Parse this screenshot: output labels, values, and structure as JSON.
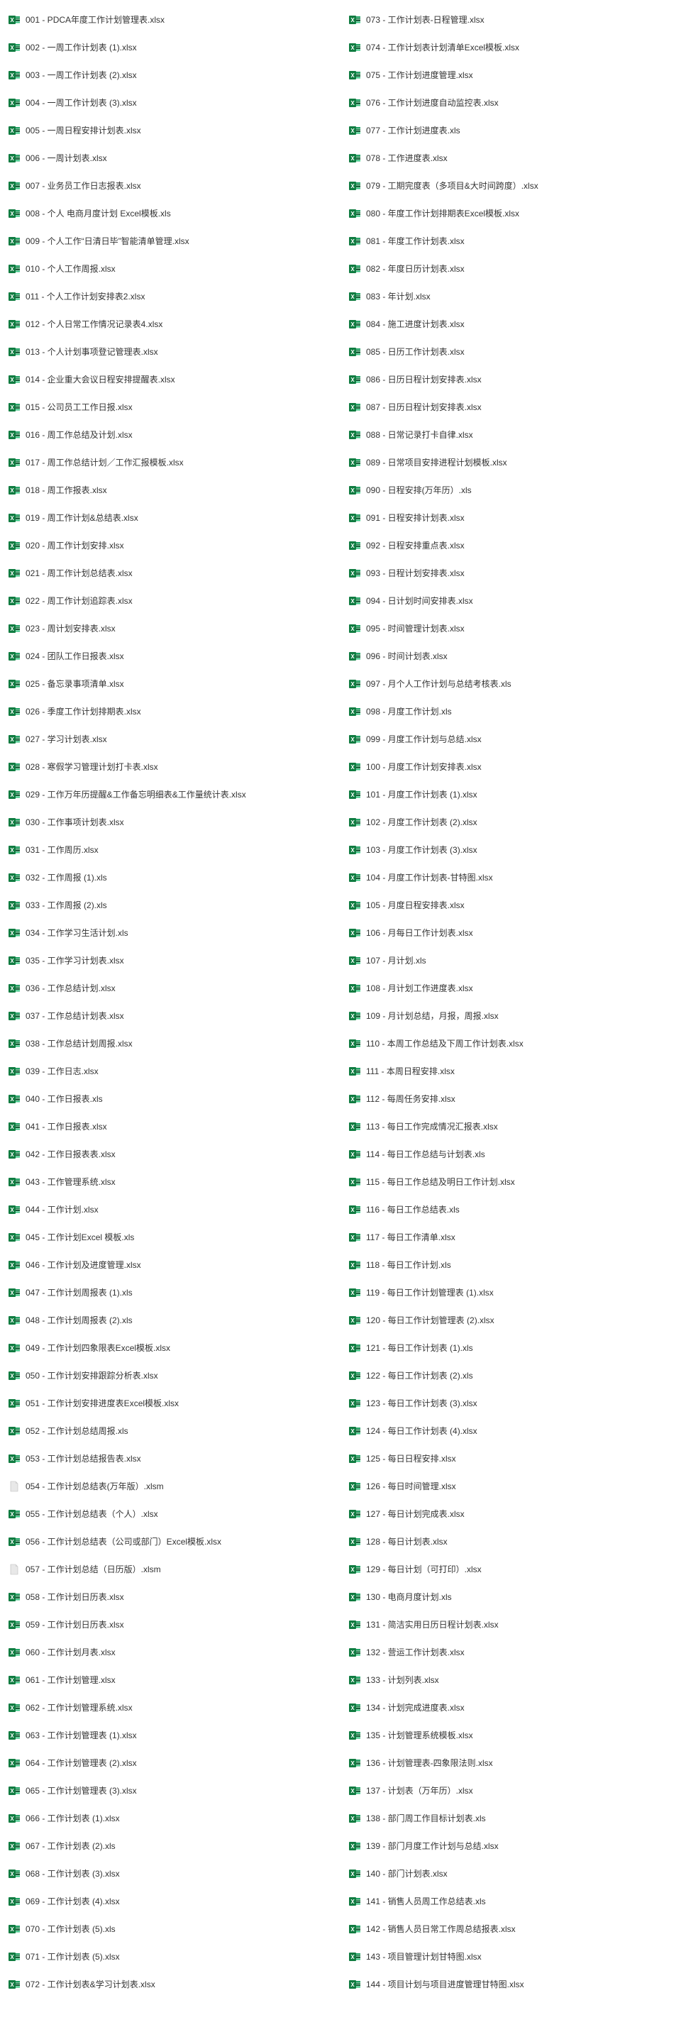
{
  "column1": [
    {
      "num": "001",
      "name": "PDCA年度工作计划管理表.xlsx",
      "type": "xlsx"
    },
    {
      "num": "002",
      "name": "一周工作计划表 (1).xlsx",
      "type": "xlsx"
    },
    {
      "num": "003",
      "name": "一周工作计划表 (2).xlsx",
      "type": "xlsx"
    },
    {
      "num": "004",
      "name": "一周工作计划表 (3).xlsx",
      "type": "xlsx"
    },
    {
      "num": "005",
      "name": "一周日程安排计划表.xlsx",
      "type": "xlsx"
    },
    {
      "num": "006",
      "name": "一周计划表.xlsx",
      "type": "xlsx"
    },
    {
      "num": "007",
      "name": "业务员工作日志报表.xlsx",
      "type": "xlsx"
    },
    {
      "num": "008",
      "name": "个人 电商月度计划 Excel模板.xls",
      "type": "xls"
    },
    {
      "num": "009",
      "name": "个人工作“日清日毕”智能清单管理.xlsx",
      "type": "xlsx"
    },
    {
      "num": "010",
      "name": "个人工作周报.xlsx",
      "type": "xlsx"
    },
    {
      "num": "011",
      "name": "个人工作计划安排表2.xlsx",
      "type": "xlsx"
    },
    {
      "num": "012",
      "name": "个人日常工作情况记录表4.xlsx",
      "type": "xlsx"
    },
    {
      "num": "013",
      "name": "个人计划事项登记管理表.xlsx",
      "type": "xlsx"
    },
    {
      "num": "014",
      "name": "企业重大会议日程安排提醒表.xlsx",
      "type": "xlsx"
    },
    {
      "num": "015",
      "name": "公司员工工作日报.xlsx",
      "type": "xlsx"
    },
    {
      "num": "016",
      "name": "周工作总结及计划.xlsx",
      "type": "xlsx"
    },
    {
      "num": "017",
      "name": "周工作总结计划／工作汇报模板.xlsx",
      "type": "xlsx"
    },
    {
      "num": "018",
      "name": "周工作报表.xlsx",
      "type": "xlsx"
    },
    {
      "num": "019",
      "name": "周工作计划&总结表.xlsx",
      "type": "xlsx"
    },
    {
      "num": "020",
      "name": "周工作计划安排.xlsx",
      "type": "xlsx"
    },
    {
      "num": "021",
      "name": "周工作计划总结表.xlsx",
      "type": "xlsx"
    },
    {
      "num": "022",
      "name": "周工作计划追踪表.xlsx",
      "type": "xlsx"
    },
    {
      "num": "023",
      "name": "周计划安排表.xlsx",
      "type": "xlsx"
    },
    {
      "num": "024",
      "name": "团队工作日报表.xlsx",
      "type": "xlsx"
    },
    {
      "num": "025",
      "name": "备忘录事项清单.xlsx",
      "type": "xlsx"
    },
    {
      "num": "026",
      "name": "季度工作计划排期表.xlsx",
      "type": "xlsx"
    },
    {
      "num": "027",
      "name": "学习计划表.xlsx",
      "type": "xlsx"
    },
    {
      "num": "028",
      "name": "寒假学习管理计划打卡表.xlsx",
      "type": "xlsx"
    },
    {
      "num": "029",
      "name": "工作万年历提醒&工作备忘明细表&工作量统计表.xlsx",
      "type": "xlsx"
    },
    {
      "num": "030",
      "name": "工作事项计划表.xlsx",
      "type": "xlsx"
    },
    {
      "num": "031",
      "name": "工作周历.xlsx",
      "type": "xlsx"
    },
    {
      "num": "032",
      "name": "工作周报 (1).xls",
      "type": "xls"
    },
    {
      "num": "033",
      "name": "工作周报 (2).xls",
      "type": "xls"
    },
    {
      "num": "034",
      "name": "工作学习生活计划.xls",
      "type": "xls"
    },
    {
      "num": "035",
      "name": "工作学习计划表.xlsx",
      "type": "xlsx"
    },
    {
      "num": "036",
      "name": "工作总结计划.xlsx",
      "type": "xlsx"
    },
    {
      "num": "037",
      "name": "工作总结计划表.xlsx",
      "type": "xlsx"
    },
    {
      "num": "038",
      "name": "工作总结计划周报.xlsx",
      "type": "xlsx"
    },
    {
      "num": "039",
      "name": "工作日志.xlsx",
      "type": "xlsx"
    },
    {
      "num": "040",
      "name": "工作日报表.xls",
      "type": "xls"
    },
    {
      "num": "041",
      "name": "工作日报表.xlsx",
      "type": "xlsx"
    },
    {
      "num": "042",
      "name": "工作日报表表.xlsx",
      "type": "xlsx"
    },
    {
      "num": "043",
      "name": "工作管理系统.xlsx",
      "type": "xlsx"
    },
    {
      "num": "044",
      "name": "工作计划.xlsx",
      "type": "xlsx"
    },
    {
      "num": "045",
      "name": "工作计划Excel 模板.xls",
      "type": "xls"
    },
    {
      "num": "046",
      "name": "工作计划及进度管理.xlsx",
      "type": "xlsx"
    },
    {
      "num": "047",
      "name": "工作计划周报表 (1).xls",
      "type": "xls"
    },
    {
      "num": "048",
      "name": "工作计划周报表 (2).xls",
      "type": "xls"
    },
    {
      "num": "049",
      "name": "工作计划四象限表Excel模板.xlsx",
      "type": "xlsx"
    },
    {
      "num": "050",
      "name": "工作计划安排跟踪分析表.xlsx",
      "type": "xlsx"
    },
    {
      "num": "051",
      "name": "工作计划安排进度表Excel模板.xlsx",
      "type": "xlsx"
    },
    {
      "num": "052",
      "name": "工作计划总结周报.xls",
      "type": "xls"
    },
    {
      "num": "053",
      "name": "工作计划总结报告表.xlsx",
      "type": "xlsx"
    },
    {
      "num": "054",
      "name": "工作计划总结表(万年版）.xlsm",
      "type": "xlsm"
    },
    {
      "num": "055",
      "name": "工作计划总结表（个人）.xlsx",
      "type": "xlsx"
    },
    {
      "num": "056",
      "name": "工作计划总结表（公司或部门）Excel模板.xlsx",
      "type": "xlsx"
    },
    {
      "num": "057",
      "name": "工作计划总结（日历版）.xlsm",
      "type": "xlsm"
    },
    {
      "num": "058",
      "name": "工作计划日历表.xlsx",
      "type": "xlsx"
    },
    {
      "num": "059",
      "name": "工作计划日历表.xlsx",
      "type": "xlsx"
    },
    {
      "num": "060",
      "name": "工作计划月表.xlsx",
      "type": "xlsx"
    },
    {
      "num": "061",
      "name": "工作计划管理.xlsx",
      "type": "xlsx"
    },
    {
      "num": "062",
      "name": "工作计划管理系统.xlsx",
      "type": "xlsx"
    },
    {
      "num": "063",
      "name": "工作计划管理表 (1).xlsx",
      "type": "xlsx"
    },
    {
      "num": "064",
      "name": "工作计划管理表 (2).xlsx",
      "type": "xlsx"
    },
    {
      "num": "065",
      "name": "工作计划管理表 (3).xlsx",
      "type": "xlsx"
    },
    {
      "num": "066",
      "name": "工作计划表 (1).xlsx",
      "type": "xlsx"
    },
    {
      "num": "067",
      "name": "工作计划表 (2).xls",
      "type": "xls"
    },
    {
      "num": "068",
      "name": "工作计划表 (3).xlsx",
      "type": "xlsx"
    },
    {
      "num": "069",
      "name": "工作计划表 (4).xlsx",
      "type": "xlsx"
    },
    {
      "num": "070",
      "name": "工作计划表 (5).xls",
      "type": "xls"
    },
    {
      "num": "071",
      "name": "工作计划表 (5).xlsx",
      "type": "xlsx"
    },
    {
      "num": "072",
      "name": "工作计划表&学习计划表.xlsx",
      "type": "xlsx"
    }
  ],
  "column2": [
    {
      "num": "073",
      "name": "工作计划表-日程管理.xlsx",
      "type": "xlsx"
    },
    {
      "num": "074",
      "name": "工作计划表计划清单Excel模板.xlsx",
      "type": "xlsx"
    },
    {
      "num": "075",
      "name": "工作计划进度管理.xlsx",
      "type": "xlsx"
    },
    {
      "num": "076",
      "name": "工作计划进度自动监控表.xlsx",
      "type": "xlsx"
    },
    {
      "num": "077",
      "name": "工作计划进度表.xls",
      "type": "xls"
    },
    {
      "num": "078",
      "name": "工作进度表.xlsx",
      "type": "xlsx"
    },
    {
      "num": "079",
      "name": "工期完度表（多项目&大时间跨度）.xlsx",
      "type": "xlsx"
    },
    {
      "num": "080",
      "name": "年度工作计划排期表Excel模板.xlsx",
      "type": "xlsx"
    },
    {
      "num": "081",
      "name": "年度工作计划表.xlsx",
      "type": "xlsx"
    },
    {
      "num": "082",
      "name": "年度日历计划表.xlsx",
      "type": "xlsx"
    },
    {
      "num": "083",
      "name": "年计划.xlsx",
      "type": "xlsx"
    },
    {
      "num": "084",
      "name": "施工进度计划表.xlsx",
      "type": "xlsx"
    },
    {
      "num": "085",
      "name": "日历工作计划表.xlsx",
      "type": "xlsx"
    },
    {
      "num": "086",
      "name": "日历日程计划安排表.xlsx",
      "type": "xlsx"
    },
    {
      "num": "087",
      "name": "日历日程计划安排表.xlsx",
      "type": "xlsx"
    },
    {
      "num": "088",
      "name": "日常记录打卡自律.xlsx",
      "type": "xlsx"
    },
    {
      "num": "089",
      "name": "日常项目安排进程计划模板.xlsx",
      "type": "xlsx"
    },
    {
      "num": "090",
      "name": "日程安排(万年历）.xls",
      "type": "xls"
    },
    {
      "num": "091",
      "name": "日程安排计划表.xlsx",
      "type": "xlsx"
    },
    {
      "num": "092",
      "name": "日程安排重点表.xlsx",
      "type": "xlsx"
    },
    {
      "num": "093",
      "name": "日程计划安排表.xlsx",
      "type": "xlsx"
    },
    {
      "num": "094",
      "name": "日计划时间安排表.xlsx",
      "type": "xlsx"
    },
    {
      "num": "095",
      "name": "时间管理计划表.xlsx",
      "type": "xlsx"
    },
    {
      "num": "096",
      "name": "时间计划表.xlsx",
      "type": "xlsx"
    },
    {
      "num": "097",
      "name": "月个人工作计划与总结考核表.xls",
      "type": "xls"
    },
    {
      "num": "098",
      "name": "月度工作计划.xls",
      "type": "xls"
    },
    {
      "num": "099",
      "name": "月度工作计划与总结.xlsx",
      "type": "xlsx"
    },
    {
      "num": "100",
      "name": "月度工作计划安排表.xlsx",
      "type": "xlsx"
    },
    {
      "num": "101",
      "name": "月度工作计划表 (1).xlsx",
      "type": "xlsx"
    },
    {
      "num": "102",
      "name": "月度工作计划表 (2).xlsx",
      "type": "xlsx"
    },
    {
      "num": "103",
      "name": "月度工作计划表 (3).xlsx",
      "type": "xlsx"
    },
    {
      "num": "104",
      "name": "月度工作计划表-甘特图.xlsx",
      "type": "xlsx"
    },
    {
      "num": "105",
      "name": "月度日程安排表.xlsx",
      "type": "xlsx"
    },
    {
      "num": "106",
      "name": "月每日工作计划表.xlsx",
      "type": "xlsx"
    },
    {
      "num": "107",
      "name": "月计划.xls",
      "type": "xls"
    },
    {
      "num": "108",
      "name": "月计划工作进度表.xlsx",
      "type": "xlsx"
    },
    {
      "num": "109",
      "name": "月计划总结，月报，周报.xlsx",
      "type": "xlsx"
    },
    {
      "num": "110",
      "name": "本周工作总结及下周工作计划表.xlsx",
      "type": "xlsx"
    },
    {
      "num": "111",
      "name": "本周日程安排.xlsx",
      "type": "xlsx"
    },
    {
      "num": "112",
      "name": "每周任务安排.xlsx",
      "type": "xlsx"
    },
    {
      "num": "113",
      "name": "每日工作完成情况汇报表.xlsx",
      "type": "xlsx"
    },
    {
      "num": "114",
      "name": "每日工作总结与计划表.xls",
      "type": "xls"
    },
    {
      "num": "115",
      "name": "每日工作总结及明日工作计划.xlsx",
      "type": "xlsx"
    },
    {
      "num": "116",
      "name": "每日工作总结表.xls",
      "type": "xls"
    },
    {
      "num": "117",
      "name": "每日工作清单.xlsx",
      "type": "xlsx"
    },
    {
      "num": "118",
      "name": "每日工作计划.xls",
      "type": "xls"
    },
    {
      "num": "119",
      "name": "每日工作计划管理表 (1).xlsx",
      "type": "xlsx"
    },
    {
      "num": "120",
      "name": "每日工作计划管理表 (2).xlsx",
      "type": "xlsx"
    },
    {
      "num": "121",
      "name": "每日工作计划表 (1).xls",
      "type": "xls"
    },
    {
      "num": "122",
      "name": "每日工作计划表 (2).xls",
      "type": "xls"
    },
    {
      "num": "123",
      "name": "每日工作计划表 (3).xlsx",
      "type": "xlsx"
    },
    {
      "num": "124",
      "name": "每日工作计划表 (4).xlsx",
      "type": "xlsx"
    },
    {
      "num": "125",
      "name": "每日日程安排.xlsx",
      "type": "xlsx"
    },
    {
      "num": "126",
      "name": "每日时间管理.xlsx",
      "type": "xlsx"
    },
    {
      "num": "127",
      "name": "每日计划完成表.xlsx",
      "type": "xlsx"
    },
    {
      "num": "128",
      "name": "每日计划表.xlsx",
      "type": "xlsx"
    },
    {
      "num": "129",
      "name": "每日计划（可打印）.xlsx",
      "type": "xlsx"
    },
    {
      "num": "130",
      "name": "电商月度计划.xls",
      "type": "xls"
    },
    {
      "num": "131",
      "name": "简洁实用日历日程计划表.xlsx",
      "type": "xlsx"
    },
    {
      "num": "132",
      "name": "营运工作计划表.xlsx",
      "type": "xlsx"
    },
    {
      "num": "133",
      "name": "计划列表.xlsx",
      "type": "xlsx"
    },
    {
      "num": "134",
      "name": "计划完成进度表.xlsx",
      "type": "xlsx"
    },
    {
      "num": "135",
      "name": "计划管理系统模板.xlsx",
      "type": "xlsx"
    },
    {
      "num": "136",
      "name": "计划管理表-四象限法则.xlsx",
      "type": "xlsx"
    },
    {
      "num": "137",
      "name": "计划表（万年历）.xlsx",
      "type": "xlsx"
    },
    {
      "num": "138",
      "name": "部门周工作目标计划表.xls",
      "type": "xls"
    },
    {
      "num": "139",
      "name": "部门月度工作计划与总结.xlsx",
      "type": "xlsx"
    },
    {
      "num": "140",
      "name": "部门计划表.xlsx",
      "type": "xlsx"
    },
    {
      "num": "141",
      "name": "销售人员周工作总结表.xls",
      "type": "xls"
    },
    {
      "num": "142",
      "name": "销售人员日常工作周总结报表.xlsx",
      "type": "xlsx"
    },
    {
      "num": "143",
      "name": "项目管理计划甘特图.xlsx",
      "type": "xlsx"
    },
    {
      "num": "144",
      "name": "项目计划与项目进度管理甘特图.xlsx",
      "type": "xlsx"
    }
  ]
}
